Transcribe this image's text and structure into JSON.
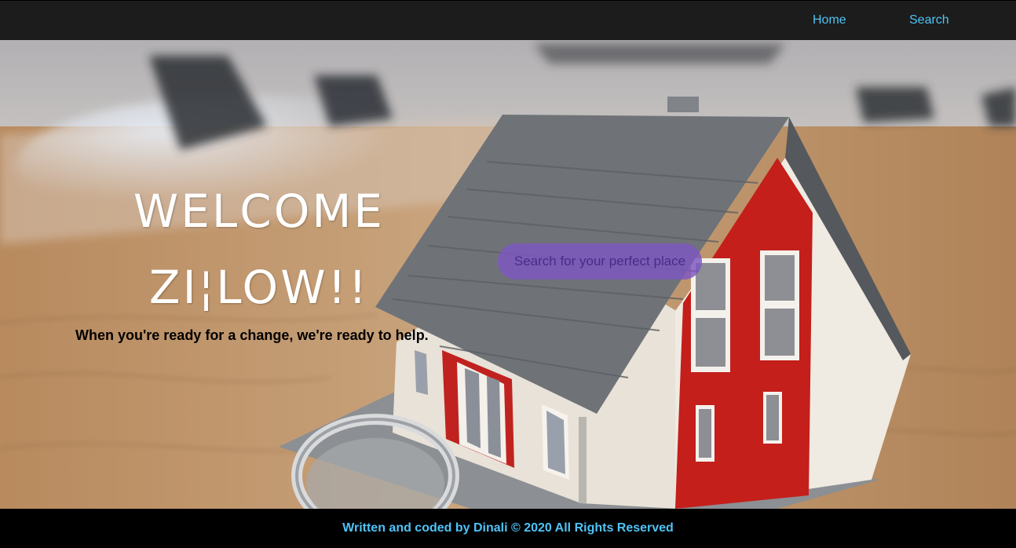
{
  "nav": {
    "home_label": "Home",
    "search_label": "Search"
  },
  "hero": {
    "welcome": "WELCOME",
    "brand": "ZI¦LOW!!",
    "tagline": "When you're ready for a change, we're ready to help.",
    "search_button_label": "Search for your perfect place",
    "background_image": "house-model-icon"
  },
  "footer": {
    "text": "Written and coded by Dinali © 2020 All Rights Reserved"
  },
  "colors": {
    "nav_background": "#1c1c1c",
    "link_accent": "#4fc3f7",
    "search_pill": "#7e57c2",
    "footer_background": "#000000"
  }
}
